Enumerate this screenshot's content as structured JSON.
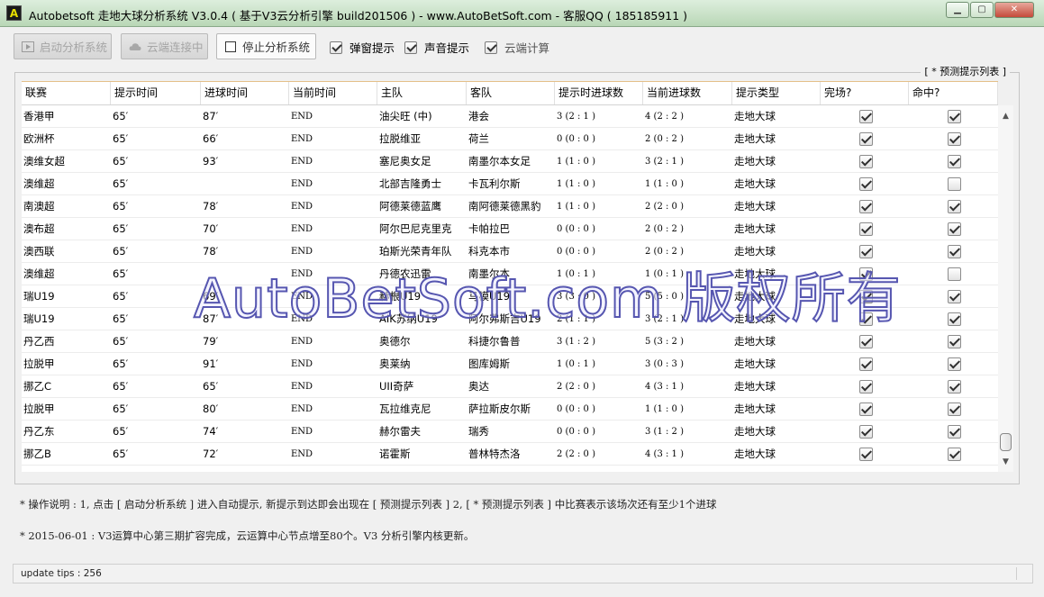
{
  "window": {
    "app_icon_letter": "A",
    "title": "Autobetsoft 走地大球分析系统 V3.0.4 ( 基于V3云分析引擎 build201506 ) - www.AutoBetSoft.com - 客服QQ ( 185185911 )"
  },
  "toolbar": {
    "start_label": "启动分析系统",
    "cloud_label": "云端连接中",
    "stop_label": "停止分析系统",
    "popup_label": "弹窗提示",
    "sound_label": "声音提示",
    "cloud_calc_label": "云端计算",
    "popup_checked": true,
    "sound_checked": true,
    "cloud_calc_checked": true
  },
  "group_title": "[ * 预测提示列表 ]",
  "columns": [
    "联赛",
    "提示时间",
    "进球时间",
    "当前时间",
    "主队",
    "客队",
    "提示时进球数",
    "当前进球数",
    "提示类型",
    "完场?",
    "命中?"
  ],
  "rows": [
    [
      "香港甲",
      "65′",
      "87′",
      "END",
      "油尖旺 (中)",
      "港会",
      "3 (2 : 1 )",
      "4 (2 : 2 )",
      "走地大球",
      true,
      true
    ],
    [
      "欧洲杯",
      "65′",
      "66′",
      "END",
      "拉脱维亚",
      "荷兰",
      "0 (0 : 0 )",
      "2 (0 : 2 )",
      "走地大球",
      true,
      true
    ],
    [
      "澳维女超",
      "65′",
      "93′",
      "END",
      "塞尼奥女足",
      "南墨尔本女足",
      "1 (1 : 0 )",
      "3 (2 : 1 )",
      "走地大球",
      true,
      true
    ],
    [
      "澳维超",
      "65′",
      "",
      "END",
      "北部吉隆勇士",
      "卡瓦利尔斯",
      "1 (1 : 0 )",
      "1 (1 : 0 )",
      "走地大球",
      true,
      false
    ],
    [
      "南澳超",
      "65′",
      "78′",
      "END",
      "阿德莱德蓝鹰",
      "南阿德莱德黑豹",
      "1 (1 : 0 )",
      "2 (2 : 0 )",
      "走地大球",
      true,
      true
    ],
    [
      "澳布超",
      "65′",
      "70′",
      "END",
      "阿尔巴尼克里克",
      "卡帕拉巴",
      "0 (0 : 0 )",
      "2 (0 : 2 )",
      "走地大球",
      true,
      true
    ],
    [
      "澳西联",
      "65′",
      "78′",
      "END",
      "珀斯光荣青年队",
      "科克本市",
      "0 (0 : 0 )",
      "2 (0 : 2 )",
      "走地大球",
      true,
      true
    ],
    [
      "澳维超",
      "65′",
      "",
      "END",
      "丹德农迅雷",
      "南墨尔本",
      "1 (0 : 1 )",
      "1 (0 : 1 )",
      "走地大球",
      true,
      false
    ],
    [
      "瑞U19",
      "65′",
      "69′",
      "END",
      "赫根U19",
      "马模U19",
      "3 (3 : 0 )",
      "5 (5 : 0 )",
      "走地大球",
      true,
      true
    ],
    [
      "瑞U19",
      "65′",
      "87′",
      "END",
      "AIK苏纳U19",
      "阿尔弗斯吉U19",
      "2 (1 : 1 )",
      "3 (2 : 1 )",
      "走地大球",
      true,
      true
    ],
    [
      "丹乙西",
      "65′",
      "79′",
      "END",
      "奥德尔",
      "科捷尔鲁普",
      "3 (1 : 2 )",
      "5 (3 : 2 )",
      "走地大球",
      true,
      true
    ],
    [
      "拉脱甲",
      "65′",
      "91′",
      "END",
      "奥莱纳",
      "图库姆斯",
      "1 (0 : 1 )",
      "3 (0 : 3 )",
      "走地大球",
      true,
      true
    ],
    [
      "挪乙C",
      "65′",
      "65′",
      "END",
      "UII奇萨",
      "奥达",
      "2 (2 : 0 )",
      "4 (3 : 1 )",
      "走地大球",
      true,
      true
    ],
    [
      "拉脱甲",
      "65′",
      "80′",
      "END",
      "瓦拉维克尼",
      "萨拉斯皮尔斯",
      "0 (0 : 0 )",
      "1 (1 : 0 )",
      "走地大球",
      true,
      true
    ],
    [
      "丹乙东",
      "65′",
      "74′",
      "END",
      "赫尔雷夫",
      "瑞秀",
      "0 (0 : 0 )",
      "3 (1 : 2 )",
      "走地大球",
      true,
      true
    ],
    [
      "挪乙B",
      "65′",
      "72′",
      "END",
      "诺霍斯",
      "普林特杰洛",
      "2 (2 : 0 )",
      "4 (3 : 1 )",
      "走地大球",
      true,
      true
    ]
  ],
  "watermark": "AutoBetSoft.com 版权所有",
  "notes": {
    "instructions": "* 操作说明 : 1, 点击 [ 启动分析系统 ] 进入自动提示, 新提示到达即会出现在 [ 预测提示列表 ] 2, [ * 预测提示列表 ] 中比赛表示该场次还有至少1个进球",
    "news": "* 2015-06-01 : V3运算中心第三期扩容完成，云运算中心节点增至80个。V3 分析引擎内核更新。"
  },
  "status": {
    "text": "update tips : 256"
  },
  "colors": {
    "title_bar": "#c9e2c6",
    "header_accent": "#e4c08a",
    "watermark_stroke": "#5656b0"
  },
  "icons": {
    "start": "play-icon",
    "cloud": "cloud-icon",
    "stop": "stop-icon",
    "minimize": "minimize-icon",
    "maximize": "maximize-icon",
    "close": "close-icon"
  }
}
